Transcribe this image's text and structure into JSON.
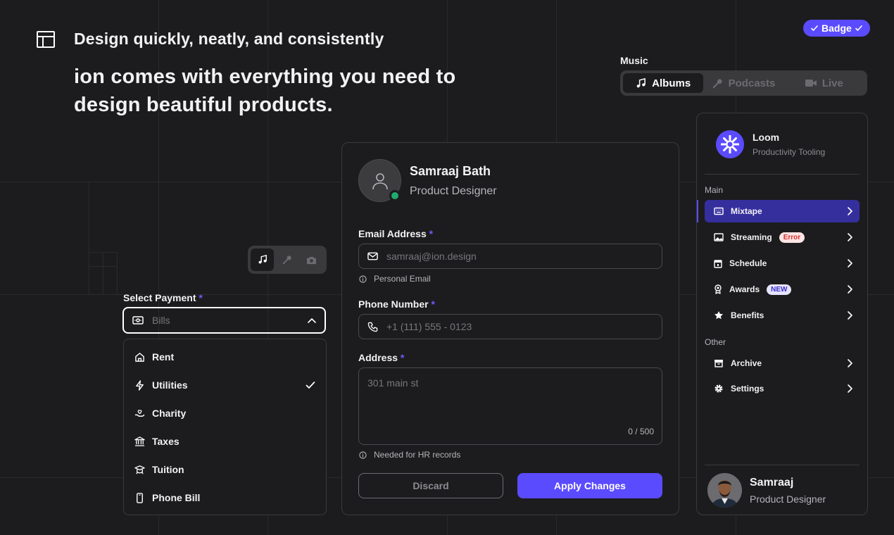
{
  "header": {
    "tagline": "Design quickly, neatly, and consistently",
    "headline": "ion comes with everything you need to design beautiful products."
  },
  "badge": {
    "label": "Badge"
  },
  "music": {
    "label": "Music",
    "tabs": [
      {
        "label": "Albums",
        "icon": "music-note-icon",
        "active": true
      },
      {
        "label": "Podcasts",
        "icon": "microphone-icon",
        "active": false
      },
      {
        "label": "Live",
        "icon": "video-camera-icon",
        "active": false
      }
    ]
  },
  "icon_toggle": {
    "items": [
      {
        "icon": "music-note-icon",
        "active": true
      },
      {
        "icon": "microphone-icon",
        "active": false
      },
      {
        "icon": "camera-icon",
        "active": false
      }
    ]
  },
  "payment": {
    "label": "Select Payment",
    "required_mark": "*",
    "placeholder": "Bills",
    "options": [
      {
        "label": "Rent",
        "icon": "house-icon",
        "selected": false
      },
      {
        "label": "Utilities",
        "icon": "lightning-icon",
        "selected": true
      },
      {
        "label": "Charity",
        "icon": "hand-heart-icon",
        "selected": false
      },
      {
        "label": "Taxes",
        "icon": "bank-icon",
        "selected": false
      },
      {
        "label": "Tuition",
        "icon": "graduation-cap-icon",
        "selected": false
      },
      {
        "label": "Phone Bill",
        "icon": "phone-device-icon",
        "selected": false
      }
    ]
  },
  "profile": {
    "name": "Samraaj Bath",
    "role": "Product Designer",
    "email": {
      "label": "Email Address",
      "required_mark": "*",
      "placeholder": "samraaj@ion.design",
      "hint": "Personal Email"
    },
    "phone": {
      "label": "Phone Number",
      "required_mark": "*",
      "placeholder": "+1 (111) 555 - 0123"
    },
    "address": {
      "label": "Address",
      "required_mark": "*",
      "placeholder": "301 main st",
      "counter": "0 / 500",
      "hint": "Needed for HR records"
    },
    "discard_label": "Discard",
    "apply_label": "Apply Changes"
  },
  "sidebar": {
    "brand_name": "Loom",
    "brand_sub": "Productivity Tooling",
    "main_label": "Main",
    "main_items": [
      {
        "label": "Mixtape",
        "icon": "keyboard-icon",
        "active": true,
        "tag": ""
      },
      {
        "label": "Streaming",
        "icon": "image-icon",
        "active": false,
        "tag": "Error"
      },
      {
        "label": "Schedule",
        "icon": "calendar-icon",
        "active": false,
        "tag": ""
      },
      {
        "label": "Awards",
        "icon": "award-icon",
        "active": false,
        "tag": "NEW"
      },
      {
        "label": "Benefits",
        "icon": "star-icon",
        "active": false,
        "tag": ""
      }
    ],
    "other_label": "Other",
    "other_items": [
      {
        "label": "Archive",
        "icon": "archive-icon"
      },
      {
        "label": "Settings",
        "icon": "gear-icon"
      }
    ],
    "user_name": "Samraaj",
    "user_role": "Product Designer"
  },
  "colors": {
    "background": "#1c1c1e",
    "accent": "#5b4bff",
    "online": "#1fa971",
    "error": "#d32f2f"
  }
}
